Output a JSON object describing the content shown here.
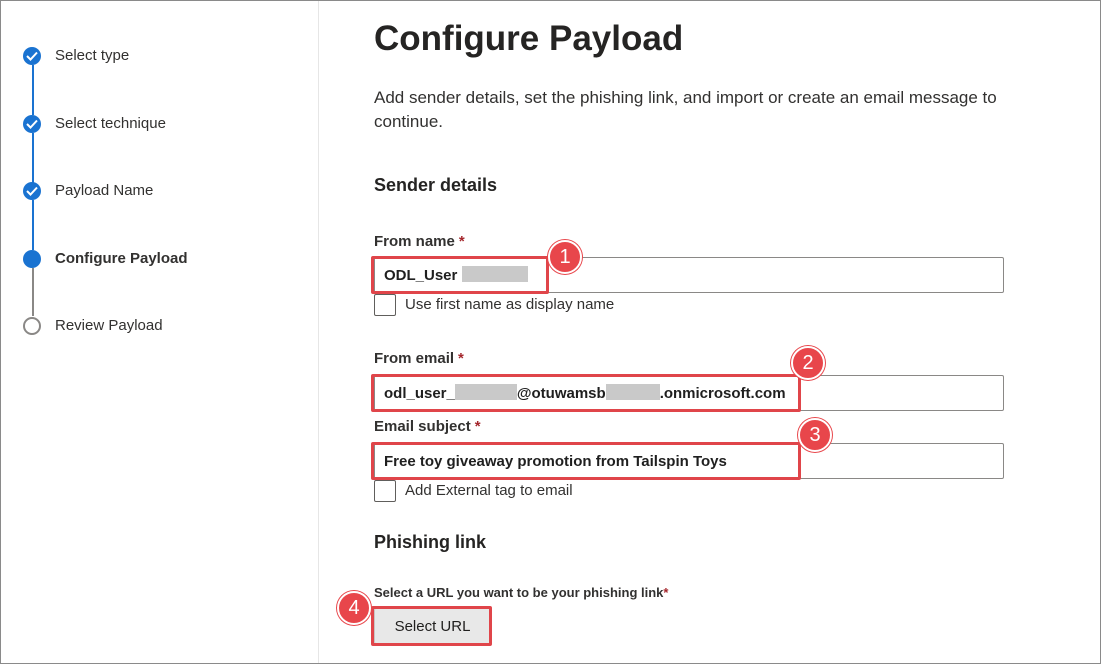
{
  "stepper": {
    "steps": [
      {
        "label": "Select type",
        "state": "completed"
      },
      {
        "label": "Select technique",
        "state": "completed"
      },
      {
        "label": "Payload Name",
        "state": "completed"
      },
      {
        "label": "Configure Payload",
        "state": "current"
      },
      {
        "label": "Review Payload",
        "state": "pending"
      }
    ]
  },
  "page": {
    "title": "Configure Payload",
    "description": "Add sender details, set the phishing link, and import or create an email message to continue."
  },
  "sender_details": {
    "heading": "Sender details",
    "from_name": {
      "label": "From name",
      "required_mark": "*",
      "value_prefix": "ODL_User",
      "callout": "1"
    },
    "first_name_checkbox": {
      "label": "Use first name as display name",
      "checked": false
    },
    "from_email": {
      "label": "From email",
      "required_mark": "*",
      "value_part1": "odl_user_",
      "value_part2": "@otuwamsb",
      "value_part3": ".onmicrosoft.com",
      "callout": "2"
    },
    "email_subject": {
      "label": "Email subject",
      "required_mark": "*",
      "value": "Free toy giveaway promotion from Tailspin Toys",
      "callout": "3"
    },
    "external_tag_checkbox": {
      "label": "Add External tag to email",
      "checked": false
    }
  },
  "phishing_link": {
    "heading": "Phishing link",
    "prompt": "Select a URL you want to be your phishing link",
    "required_mark": "*",
    "button_label": "Select URL",
    "callout": "4"
  },
  "colors": {
    "accent": "#1a73d1",
    "callout": "#e8464b",
    "required": "#a4262c"
  }
}
